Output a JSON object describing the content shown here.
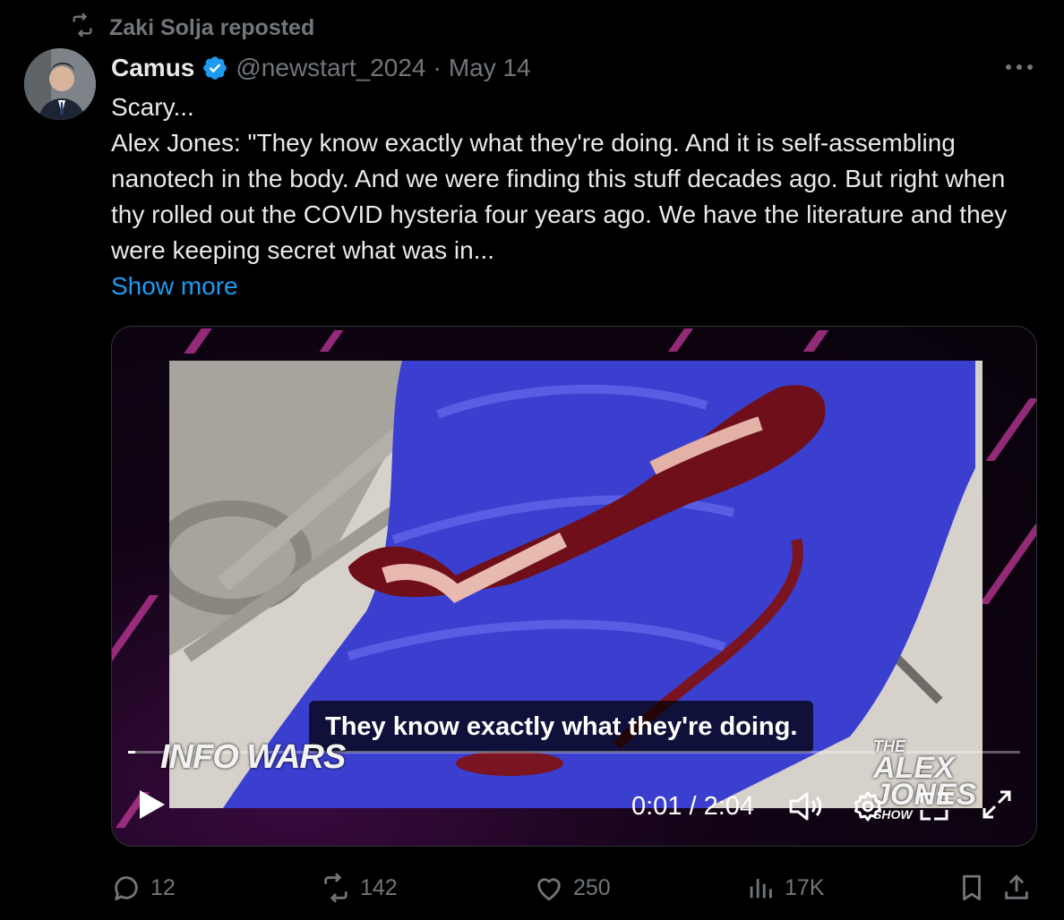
{
  "repost": {
    "text": "Zaki Solja reposted",
    "icon": "repost-icon"
  },
  "author": {
    "name": "Camus",
    "handle": "@newstart_2024",
    "separator": "·",
    "date": "May 14",
    "verified_color": "#1d9bf0"
  },
  "tweet": {
    "line1": "Scary...",
    "line2": "Alex Jones: \"They know exactly what they're doing. And it is self-assembling nanotech in the body. And we were finding this stuff decades ago. But right when thy rolled out the COVID hysteria four years ago. We have the literature and they were keeping secret what was in...",
    "show_more": "Show more"
  },
  "video": {
    "caption": "They know exactly what they're doing.",
    "time": "0:01 / 2:04",
    "progress_fraction": 0.008,
    "logo_left": "INFO WARS",
    "logo_right_1": "THE",
    "logo_right_2": "ALEX",
    "logo_right_3": "JONES",
    "logo_right_4": "SHOW"
  },
  "actions": {
    "replies": "12",
    "reposts": "142",
    "likes": "250",
    "views": "17K"
  },
  "colors": {
    "background": "#000000",
    "text": "#e7e9ea",
    "muted": "#71767b",
    "link": "#1d9bf0"
  }
}
